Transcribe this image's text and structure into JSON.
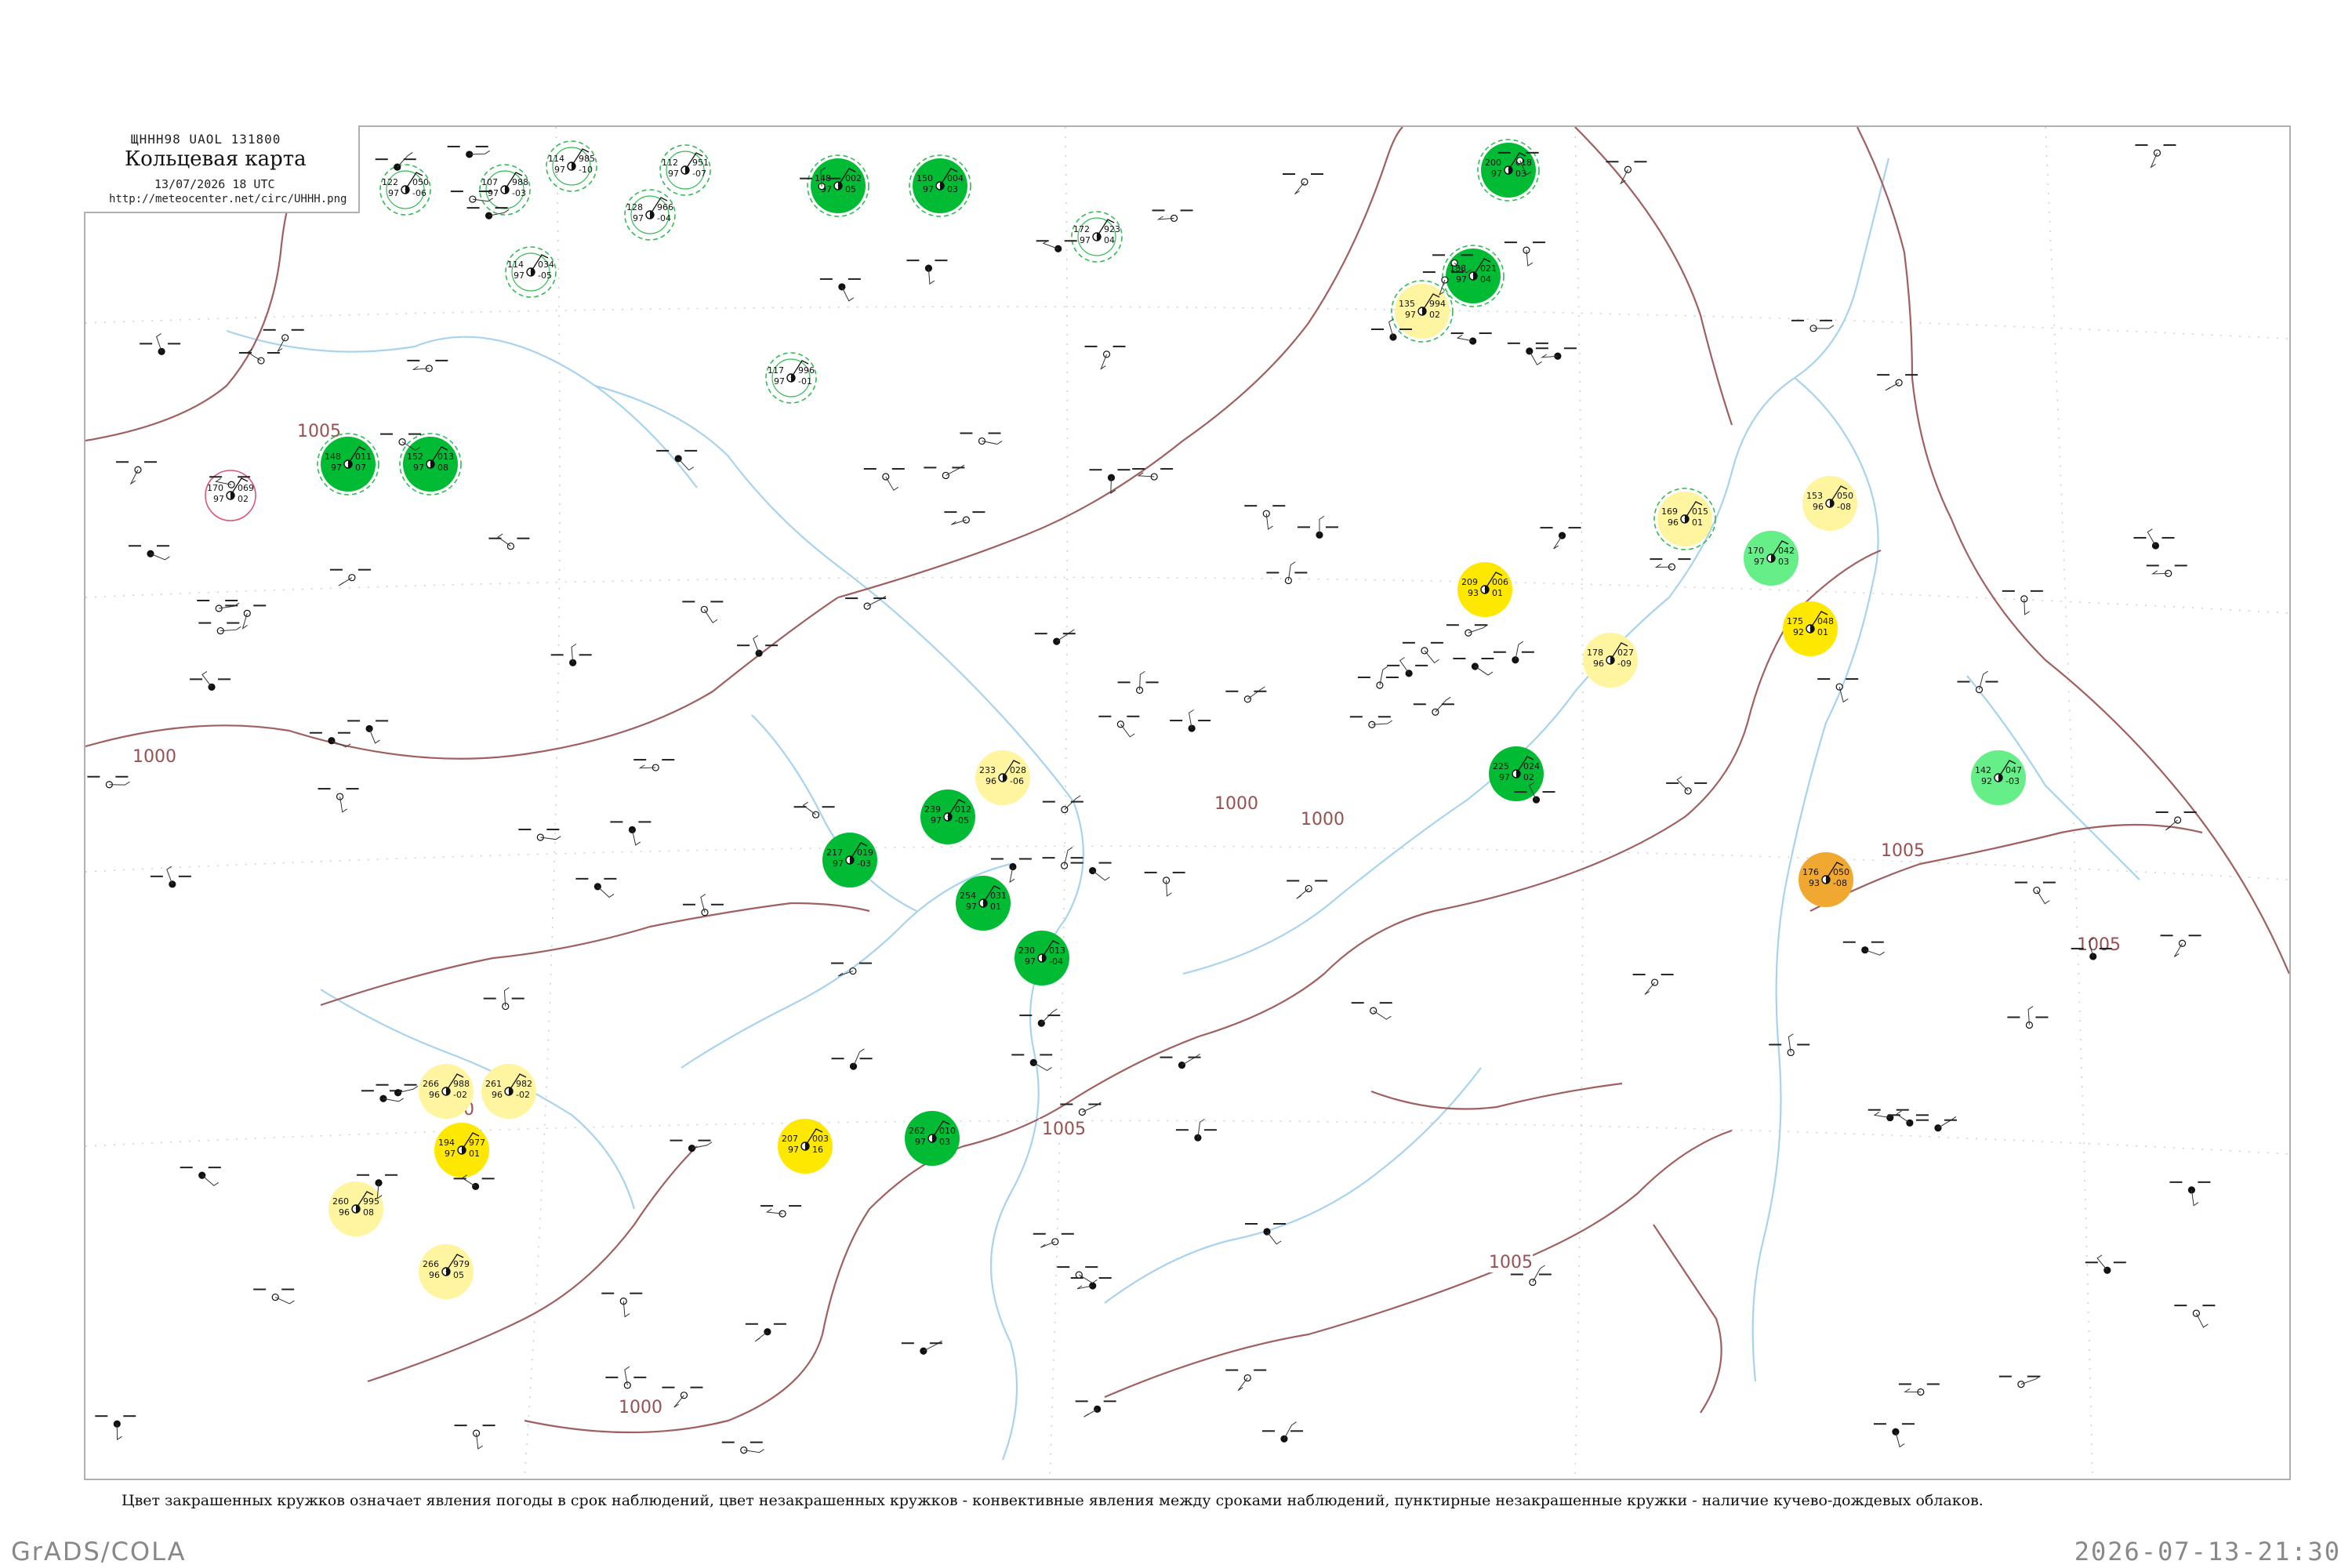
{
  "header": {
    "code": "ЩННН98  UAOL  131800",
    "title": "Кольцевая карта",
    "date": "13/07/2026 18 UTC",
    "url": "http://meteocenter.net/circ/UHHH.png"
  },
  "legend": "Цвет закрашенных кружков означает явления погоды в срок наблюдений, цвет незакрашенных кружков - конвективные явления между сроками наблюдений, пунктирные незакрашенные кружки - наличие кучево-дождевых облаков.",
  "footer": {
    "left": "GrADS/COLA",
    "right": "2026-07-13-21:30"
  },
  "colors": {
    "rain": "#00bb33",
    "fog": "#ffff55",
    "shower": "#ffe800",
    "haze": "#fff5a0",
    "thunder": "#ee2244",
    "dust": "#f0a830",
    "light": "#66ee88",
    "isobar": "#a06060",
    "river": "#99ccee",
    "cb_ring": "#33bb55",
    "ts_ring": "#dd5577"
  },
  "isobar_labels": [
    "1005",
    "1005",
    "1000",
    "1000",
    "1000",
    "1000",
    "1005",
    "1005",
    "1005",
    "1000"
  ],
  "stations": [
    {
      "name": "st-a1",
      "t": "122",
      "p": "050",
      "d": "97",
      "v": "-06",
      "color": "none",
      "ring": "cb"
    },
    {
      "name": "st-a2",
      "t": "107",
      "p": "988",
      "d": "97",
      "v": "-03",
      "color": "none",
      "ring": "cb"
    },
    {
      "name": "st-a3",
      "t": "114",
      "p": "985",
      "d": "97",
      "v": "-10",
      "color": "none",
      "ring": "cb"
    },
    {
      "name": "st-a4",
      "t": "112",
      "p": "951",
      "d": "97",
      "v": "-07",
      "color": "none",
      "ring": "cb"
    },
    {
      "name": "st-a5",
      "t": "128",
      "p": "966",
      "d": "97",
      "v": "-04",
      "color": "none",
      "ring": "cb"
    },
    {
      "name": "st-a6",
      "t": "114",
      "p": "034",
      "d": "97",
      "v": "-05",
      "color": "none",
      "ring": "cb"
    },
    {
      "name": "st-a7",
      "t": "117",
      "p": "996",
      "d": "97",
      "v": "-01",
      "color": "none",
      "ring": "cb"
    },
    {
      "name": "st-a8",
      "t": "172",
      "p": "923",
      "d": "97",
      "v": "04",
      "color": "none",
      "ring": "cb"
    },
    {
      "name": "st-g1",
      "t": "148",
      "p": "002",
      "d": "97",
      "v": "05",
      "color": "rain",
      "ring": "cb"
    },
    {
      "name": "st-g2",
      "t": "150",
      "p": "004",
      "d": "97",
      "v": "03",
      "color": "rain",
      "ring": "cb"
    },
    {
      "name": "st-g3",
      "t": "148",
      "p": "011",
      "d": "97",
      "v": "07",
      "color": "rain",
      "ring": "cb"
    },
    {
      "name": "st-g4",
      "t": "152",
      "p": "013",
      "d": "97",
      "v": "08",
      "color": "rain",
      "ring": "cb"
    },
    {
      "name": "st-r1",
      "t": "170",
      "p": "069",
      "d": "97",
      "v": "02",
      "color": "none",
      "ring": "ts"
    },
    {
      "name": "st-y1",
      "t": "135",
      "p": "994",
      "d": "97",
      "v": "02",
      "color": "haze",
      "ring": "cb"
    },
    {
      "name": "st-y2",
      "t": "209",
      "p": "006",
      "d": "93",
      "v": "01",
      "color": "shower",
      "ring": "none"
    },
    {
      "name": "st-y3",
      "t": "178",
      "p": "027",
      "d": "96",
      "v": "-09",
      "color": "haze",
      "ring": "none"
    },
    {
      "name": "st-y4",
      "t": "153",
      "p": "050",
      "d": "96",
      "v": "-08",
      "color": "haze",
      "ring": "none"
    },
    {
      "name": "st-y5",
      "t": "175",
      "p": "048",
      "d": "92",
      "v": "01",
      "color": "shower",
      "ring": "none"
    },
    {
      "name": "st-y6",
      "t": "169",
      "p": "015",
      "d": "96",
      "v": "01",
      "color": "haze",
      "ring": "cb"
    },
    {
      "name": "st-y7",
      "t": "233",
      "p": "028",
      "d": "96",
      "v": "-06",
      "color": "haze",
      "ring": "none"
    },
    {
      "name": "st-y8",
      "t": "266",
      "p": "988",
      "d": "96",
      "v": "-02",
      "color": "haze",
      "ring": "none"
    },
    {
      "name": "st-y9",
      "t": "261",
      "p": "982",
      "d": "96",
      "v": "-02",
      "color": "haze",
      "ring": "none"
    },
    {
      "name": "st-y10",
      "t": "194",
      "p": "977",
      "d": "97",
      "v": "01",
      "color": "shower",
      "ring": "none"
    },
    {
      "name": "st-y11",
      "t": "207",
      "p": "003",
      "d": "97",
      "v": "16",
      "color": "shower",
      "ring": "none"
    },
    {
      "name": "st-y12",
      "t": "260",
      "p": "995",
      "d": "96",
      "v": "08",
      "color": "haze",
      "ring": "none"
    },
    {
      "name": "st-y13",
      "t": "266",
      "p": "979",
      "d": "96",
      "v": "05",
      "color": "haze",
      "ring": "none"
    },
    {
      "name": "st-o1",
      "t": "176",
      "p": "050",
      "d": "93",
      "v": "-08",
      "color": "dust",
      "ring": "none"
    },
    {
      "name": "st-l1",
      "t": "170",
      "p": "042",
      "d": "97",
      "v": "03",
      "color": "light",
      "ring": "none"
    },
    {
      "name": "st-l2",
      "t": "142",
      "p": "047",
      "d": "92",
      "v": "-03",
      "color": "light",
      "ring": "none"
    },
    {
      "name": "st-g5",
      "t": "200",
      "p": "018",
      "d": "97",
      "v": "03",
      "color": "rain",
      "ring": "cb"
    },
    {
      "name": "st-g6",
      "t": "188",
      "p": "021",
      "d": "97",
      "v": "04",
      "color": "rain",
      "ring": "cb"
    },
    {
      "name": "st-g7",
      "t": "225",
      "p": "024",
      "d": "97",
      "v": "02",
      "color": "rain",
      "ring": "none"
    },
    {
      "name": "st-g8",
      "t": "239",
      "p": "012",
      "d": "97",
      "v": "-05",
      "color": "rain",
      "ring": "none"
    },
    {
      "name": "st-g9",
      "t": "217",
      "p": "019",
      "d": "97",
      "v": "-03",
      "color": "rain",
      "ring": "none"
    },
    {
      "name": "st-g10",
      "t": "254",
      "p": "031",
      "d": "97",
      "v": "01",
      "color": "rain",
      "ring": "none"
    },
    {
      "name": "st-g11",
      "t": "230",
      "p": "013",
      "d": "97",
      "v": "-04",
      "color": "rain",
      "ring": "none"
    },
    {
      "name": "st-g12",
      "t": "262",
      "p": "010",
      "d": "97",
      "v": "03",
      "color": "rain",
      "ring": "none"
    }
  ]
}
